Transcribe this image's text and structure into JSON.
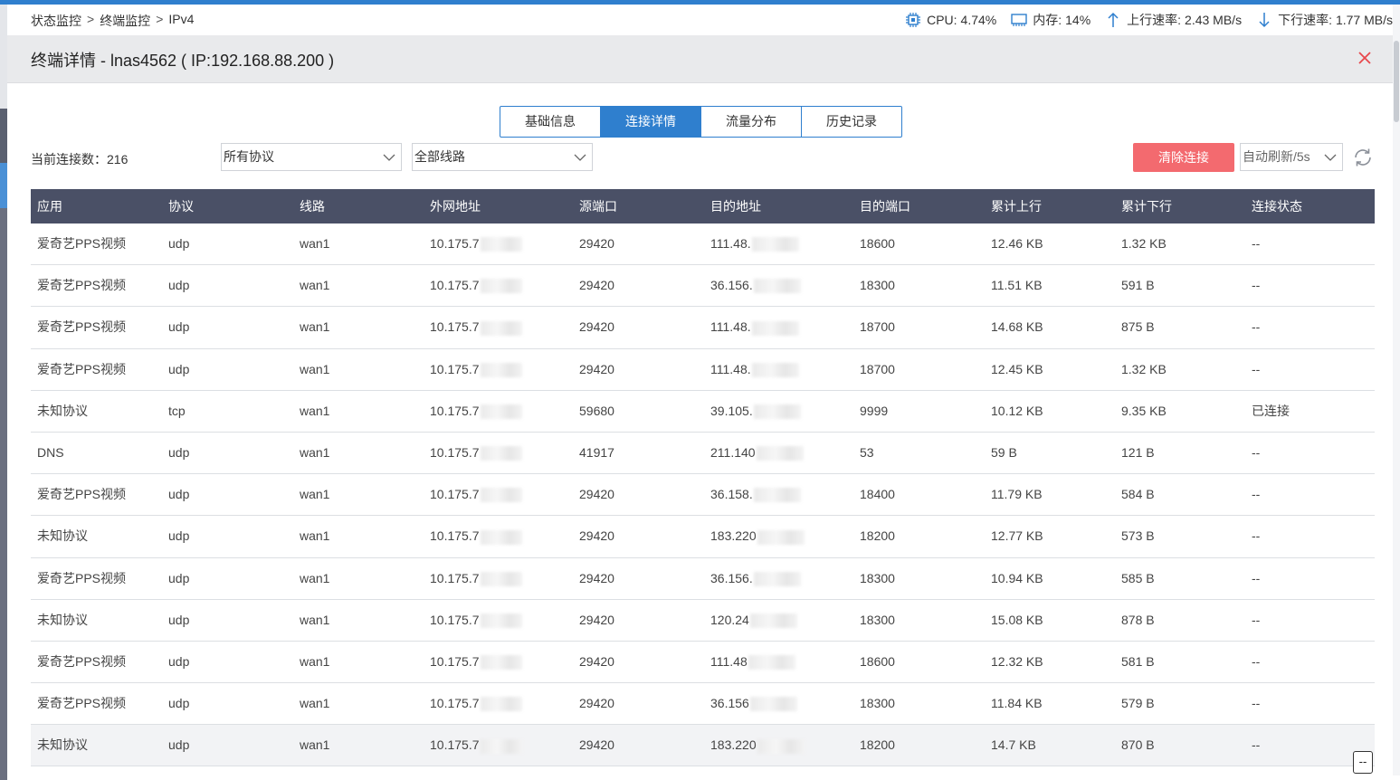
{
  "breadcrumb": [
    "状态监控",
    "终端监控",
    "IPv4"
  ],
  "breadcrumb_sep": ">",
  "sysinfo": {
    "cpu_label": "CPU:",
    "cpu_value": "4.74%",
    "mem_label": "内存:",
    "mem_value": "14%",
    "up_label": "上行速率:",
    "up_value": "2.43 MB/s",
    "down_label": "下行速率:",
    "down_value": "1.77 MB/s"
  },
  "dialog": {
    "title": "终端详情 - lnas4562 ( IP:192.168.88.200 )"
  },
  "tabs": [
    {
      "label": "基础信息",
      "active": false
    },
    {
      "label": "连接详情",
      "active": true
    },
    {
      "label": "流量分布",
      "active": false
    },
    {
      "label": "历史记录",
      "active": false
    }
  ],
  "toolbar": {
    "conn_count_label": "当前连接数：216",
    "protocol_select": "所有协议",
    "line_select": "全部线路",
    "clear_button": "清除连接",
    "refresh_select": "自动刷新/5s"
  },
  "table": {
    "columns": [
      "应用",
      "协议",
      "线路",
      "外网地址",
      "源端口",
      "目的地址",
      "目的端口",
      "累计上行",
      "累计下行",
      "连接状态"
    ],
    "rows": [
      [
        "爱奇艺PPS视频",
        "udp",
        "wan1",
        "10.175.7",
        "29420",
        "111.48.",
        "18600",
        "12.46 KB",
        "1.32 KB",
        "--"
      ],
      [
        "爱奇艺PPS视频",
        "udp",
        "wan1",
        "10.175.7",
        "29420",
        "36.156.",
        "18300",
        "11.51 KB",
        "591 B",
        "--"
      ],
      [
        "爱奇艺PPS视频",
        "udp",
        "wan1",
        "10.175.7",
        "29420",
        "111.48.",
        "18700",
        "14.68 KB",
        "875 B",
        "--"
      ],
      [
        "爱奇艺PPS视频",
        "udp",
        "wan1",
        "10.175.7",
        "29420",
        "111.48.",
        "18700",
        "12.45 KB",
        "1.32 KB",
        "--"
      ],
      [
        "未知协议",
        "tcp",
        "wan1",
        "10.175.7",
        "59680",
        "39.105.",
        "9999",
        "10.12 KB",
        "9.35 KB",
        "已连接"
      ],
      [
        "DNS",
        "udp",
        "wan1",
        "10.175.7",
        "41917",
        "211.140",
        "53",
        "59 B",
        "121 B",
        "--"
      ],
      [
        "爱奇艺PPS视频",
        "udp",
        "wan1",
        "10.175.7",
        "29420",
        "36.158.",
        "18400",
        "11.79 KB",
        "584 B",
        "--"
      ],
      [
        "未知协议",
        "udp",
        "wan1",
        "10.175.7",
        "29420",
        "183.220",
        "18200",
        "12.77 KB",
        "573 B",
        "--"
      ],
      [
        "爱奇艺PPS视频",
        "udp",
        "wan1",
        "10.175.7",
        "29420",
        "36.156.",
        "18300",
        "10.94 KB",
        "585 B",
        "--"
      ],
      [
        "未知协议",
        "udp",
        "wan1",
        "10.175.7",
        "29420",
        "120.24",
        "18300",
        "15.08 KB",
        "878 B",
        "--"
      ],
      [
        "爱奇艺PPS视频",
        "udp",
        "wan1",
        "10.175.7",
        "29420",
        "111.48",
        "18600",
        "12.32 KB",
        "581 B",
        "--"
      ],
      [
        "爱奇艺PPS视频",
        "udp",
        "wan1",
        "10.175.7",
        "29420",
        "36.156",
        "18300",
        "11.84 KB",
        "579 B",
        "--"
      ],
      [
        "未知协议",
        "udp",
        "wan1",
        "10.175.7",
        "29420",
        "183.220",
        "18200",
        "14.7 KB",
        "870 B",
        "--"
      ]
    ]
  },
  "corner_button": "--",
  "colors": {
    "accent": "#2f7fce",
    "header_bg": "#4a5066",
    "danger": "#f36a6f",
    "close": "#e8474c"
  }
}
